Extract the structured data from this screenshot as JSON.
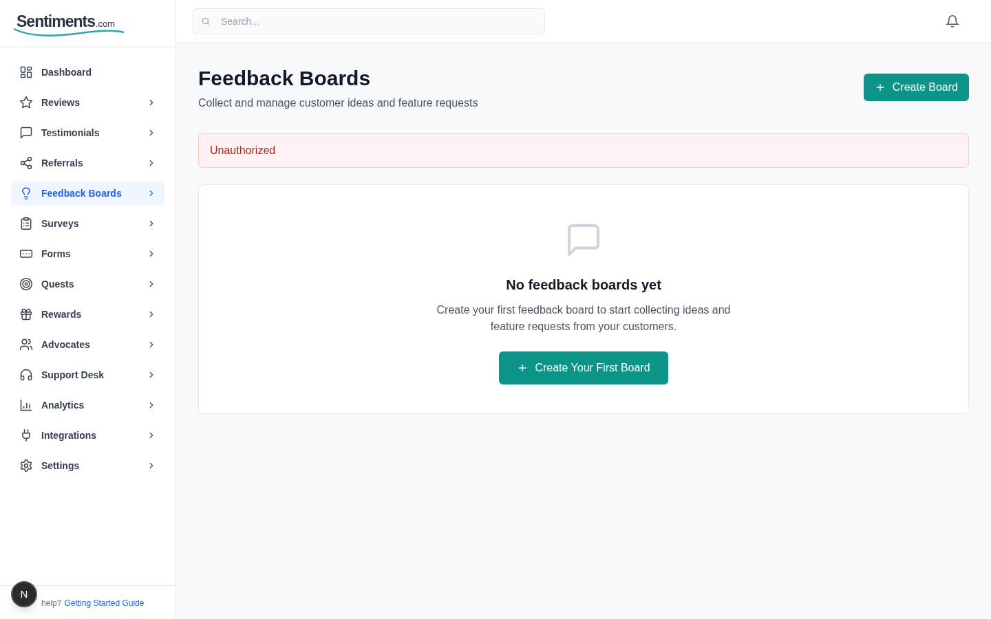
{
  "logo": {
    "name": "Sentiments",
    "suffix": ".com"
  },
  "search": {
    "placeholder": "Search..."
  },
  "sidebar": {
    "items": [
      {
        "label": "Dashboard",
        "has_children": false,
        "selected": false
      },
      {
        "label": "Reviews",
        "has_children": true,
        "selected": false
      },
      {
        "label": "Testimonials",
        "has_children": true,
        "selected": false
      },
      {
        "label": "Referrals",
        "has_children": true,
        "selected": false
      },
      {
        "label": "Feedback Boards",
        "has_children": true,
        "selected": true
      },
      {
        "label": "Surveys",
        "has_children": true,
        "selected": false
      },
      {
        "label": "Forms",
        "has_children": true,
        "selected": false
      },
      {
        "label": "Quests",
        "has_children": true,
        "selected": false
      },
      {
        "label": "Rewards",
        "has_children": true,
        "selected": false
      },
      {
        "label": "Advocates",
        "has_children": true,
        "selected": false
      },
      {
        "label": "Support Desk",
        "has_children": true,
        "selected": false
      },
      {
        "label": "Analytics",
        "has_children": true,
        "selected": false
      },
      {
        "label": "Integrations",
        "has_children": true,
        "selected": false
      },
      {
        "label": "Settings",
        "has_children": true,
        "selected": false
      }
    ],
    "help": {
      "text": "help?",
      "link": "Getting Started Guide"
    },
    "badge": "N"
  },
  "page": {
    "title": "Feedback Boards",
    "subtitle": "Collect and manage customer ideas and feature requests",
    "create_button": "Create Board"
  },
  "alert": "Unauthorized",
  "empty_state": {
    "title": "No feedback boards yet",
    "text": "Create your first feedback board to start collecting ideas and feature requests from your customers.",
    "button": "Create Your First Board"
  }
}
